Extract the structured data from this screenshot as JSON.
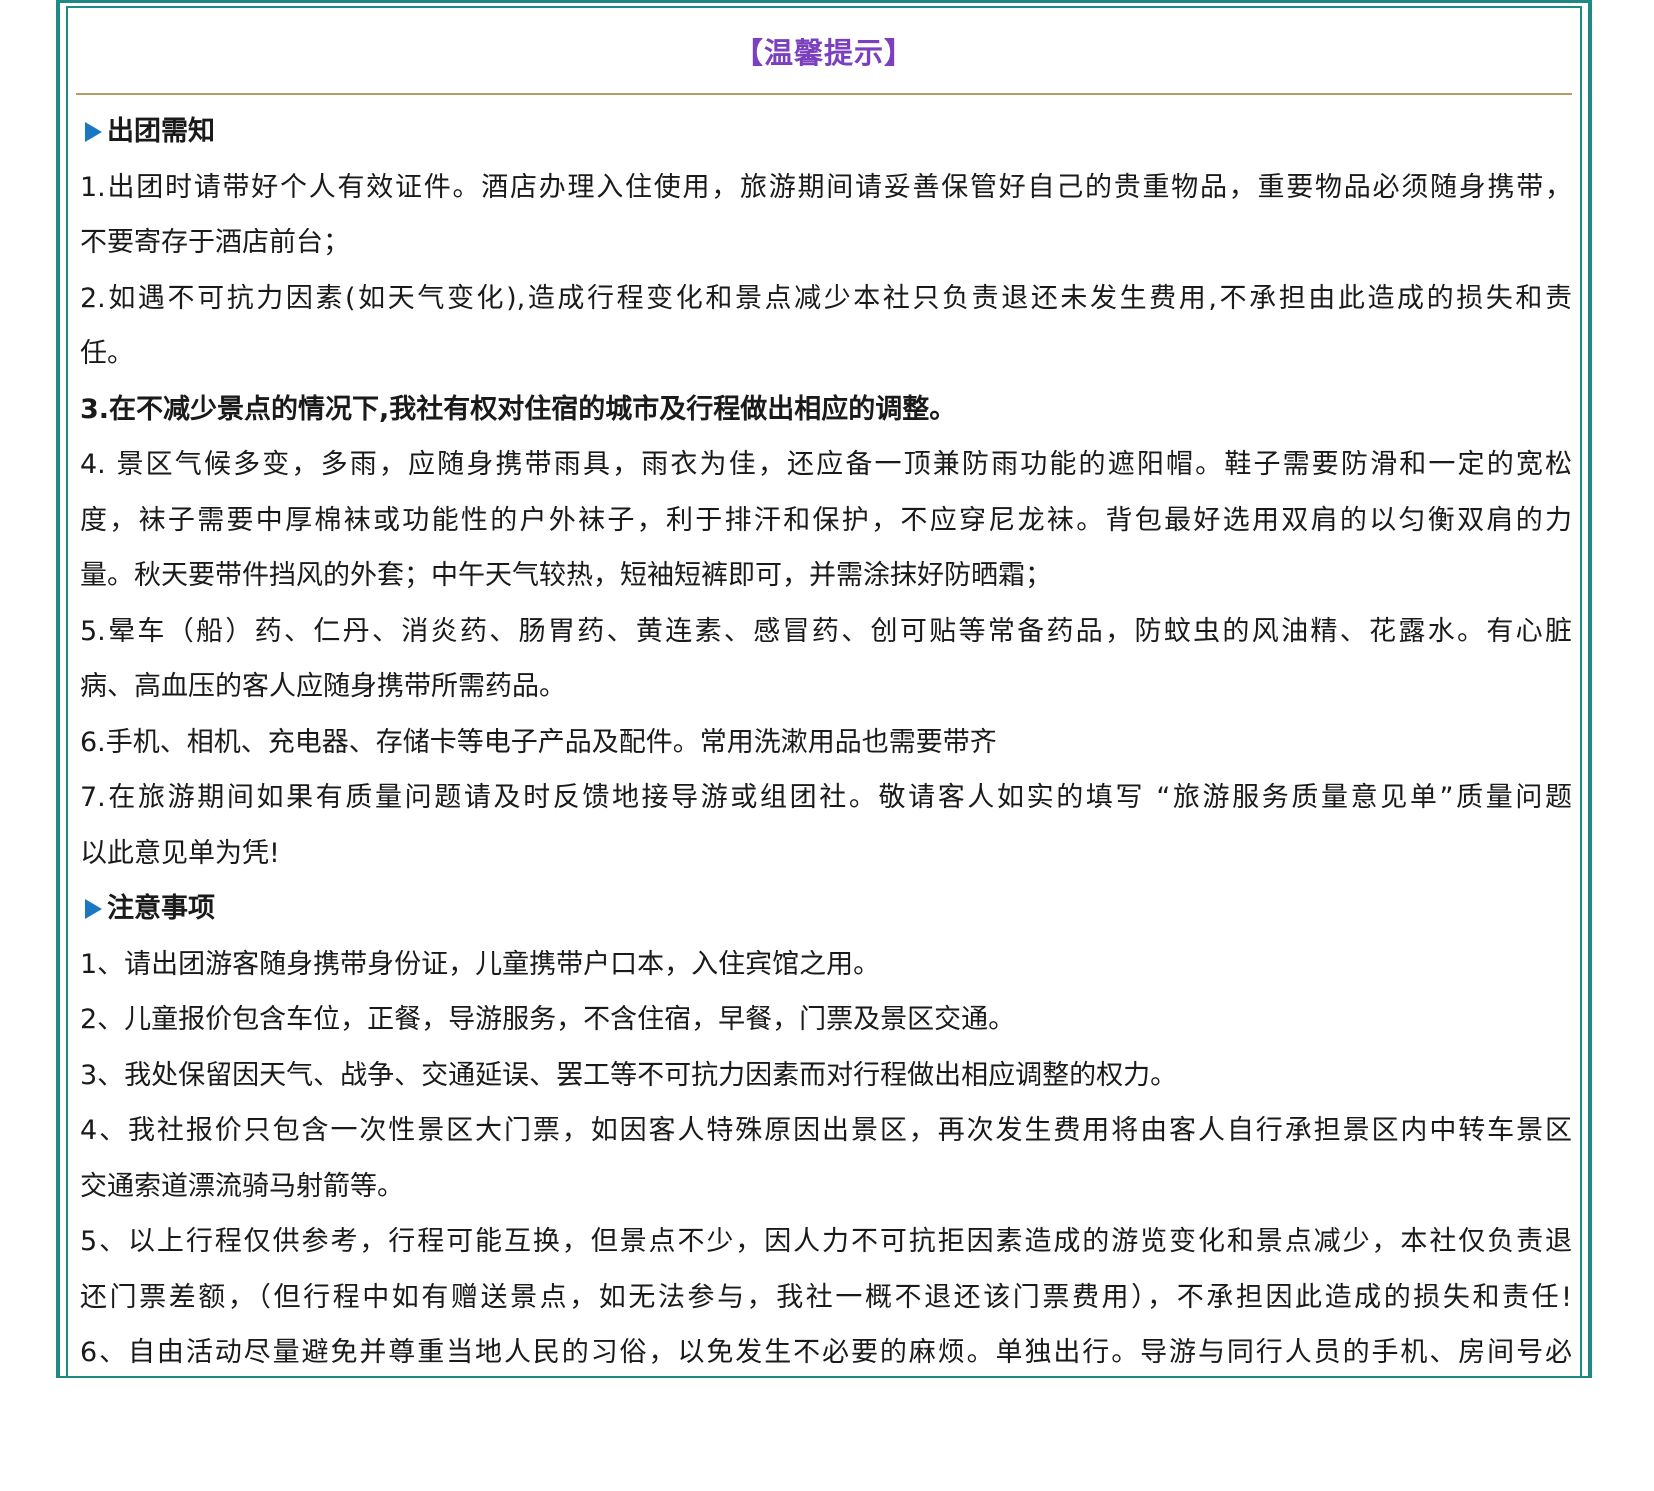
{
  "title": "【温馨提示】",
  "sections": [
    {
      "heading": "出团需知",
      "lines": [
        "1.出团时请带好个人有效证件。酒店办理入住使用，旅游期间请妥善保管好自己的贵重物品，重要物品必须随身携带，",
        "不要寄存于酒店前台；",
        "2.如遇不可抗力因素(如天气变化),造成行程变化和景点减少本社只负责退还未发生费用,不承担由此造成的损失和责",
        "任。",
        "3.在不减少景点的情况下,我社有权对住宿的城市及行程做出相应的调整。",
        "4. 景区气候多变，多雨，应随身携带雨具，雨衣为佳，还应备一顶兼防雨功能的遮阳帽。鞋子需要防滑和一定的宽松",
        "度，袜子需要中厚棉袜或功能性的户外袜子，利于排汗和保护，不应穿尼龙袜。背包最好选用双肩的以匀衡双肩的力",
        "量。秋天要带件挡风的外套；中午天气较热，短袖短裤即可，并需涂抹好防晒霜；",
        "5.晕车（船）药、仁丹、消炎药、肠胃药、黄连素、感冒药、创可贴等常备药品，防蚊虫的风油精、花露水。有心脏",
        "病、高血压的客人应随身携带所需药品。",
        "6.手机、相机、充电器、存储卡等电子产品及配件。常用洗漱用品也需要带齐",
        "7.在旅游期间如果有质量问题请及时反馈地接导游或组团社。敬请客人如实的填写 “旅游服务质量意见单”质量问题",
        "以此意见单为凭!"
      ]
    },
    {
      "heading": "注意事项",
      "lines": [
        "1、请出团游客随身携带身份证，儿童携带户口本，入住宾馆之用。",
        "2、儿童报价包含车位，正餐，导游服务，不含住宿，早餐，门票及景区交通。",
        "3、我处保留因天气、战争、交通延误、罢工等不可抗力因素而对行程做出相应调整的权力。",
        "4、我社报价只包含一次性景区大门票，如因客人特殊原因出景区，再次发生费用将由客人自行承担景区内中转车景区",
        "交通索道漂流骑马射箭等。",
        "5、以上行程仅供参考，行程可能互换，但景点不少，因人力不可抗拒因素造成的游览变化和景点减少，本社仅负责退",
        "还门票差额，（但行程中如有赠送景点，如无法参与，我社一概不退还该门票费用），不承担因此造成的损失和责任!",
        "6、自由活动尽量避免并尊重当地人民的习俗，以免发生不必要的麻烦。单独出行。导游与同行人员的手机、房间号必"
      ]
    }
  ]
}
